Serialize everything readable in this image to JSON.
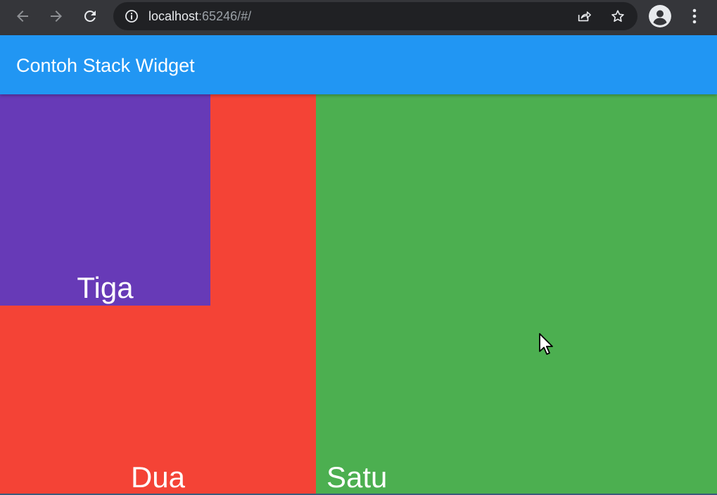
{
  "browser": {
    "url_host": "localhost",
    "url_rest": ":65246/#/"
  },
  "app_bar": {
    "title": "Contoh Stack Widget",
    "color": "#2196f3"
  },
  "stack": {
    "satu": {
      "label": "Satu",
      "color": "#4caf50"
    },
    "dua": {
      "label": "Dua",
      "color": "#f44336"
    },
    "tiga": {
      "label": "Tiga",
      "color": "#673ab7"
    }
  },
  "icons": {
    "back": "arrow-left-icon",
    "forward": "arrow-right-icon",
    "reload": "reload-icon",
    "site_info": "info-icon",
    "share": "share-icon",
    "bookmark": "star-icon",
    "profile": "person-icon",
    "menu": "kebab-menu-icon",
    "cursor": "mouse-pointer-icon"
  }
}
